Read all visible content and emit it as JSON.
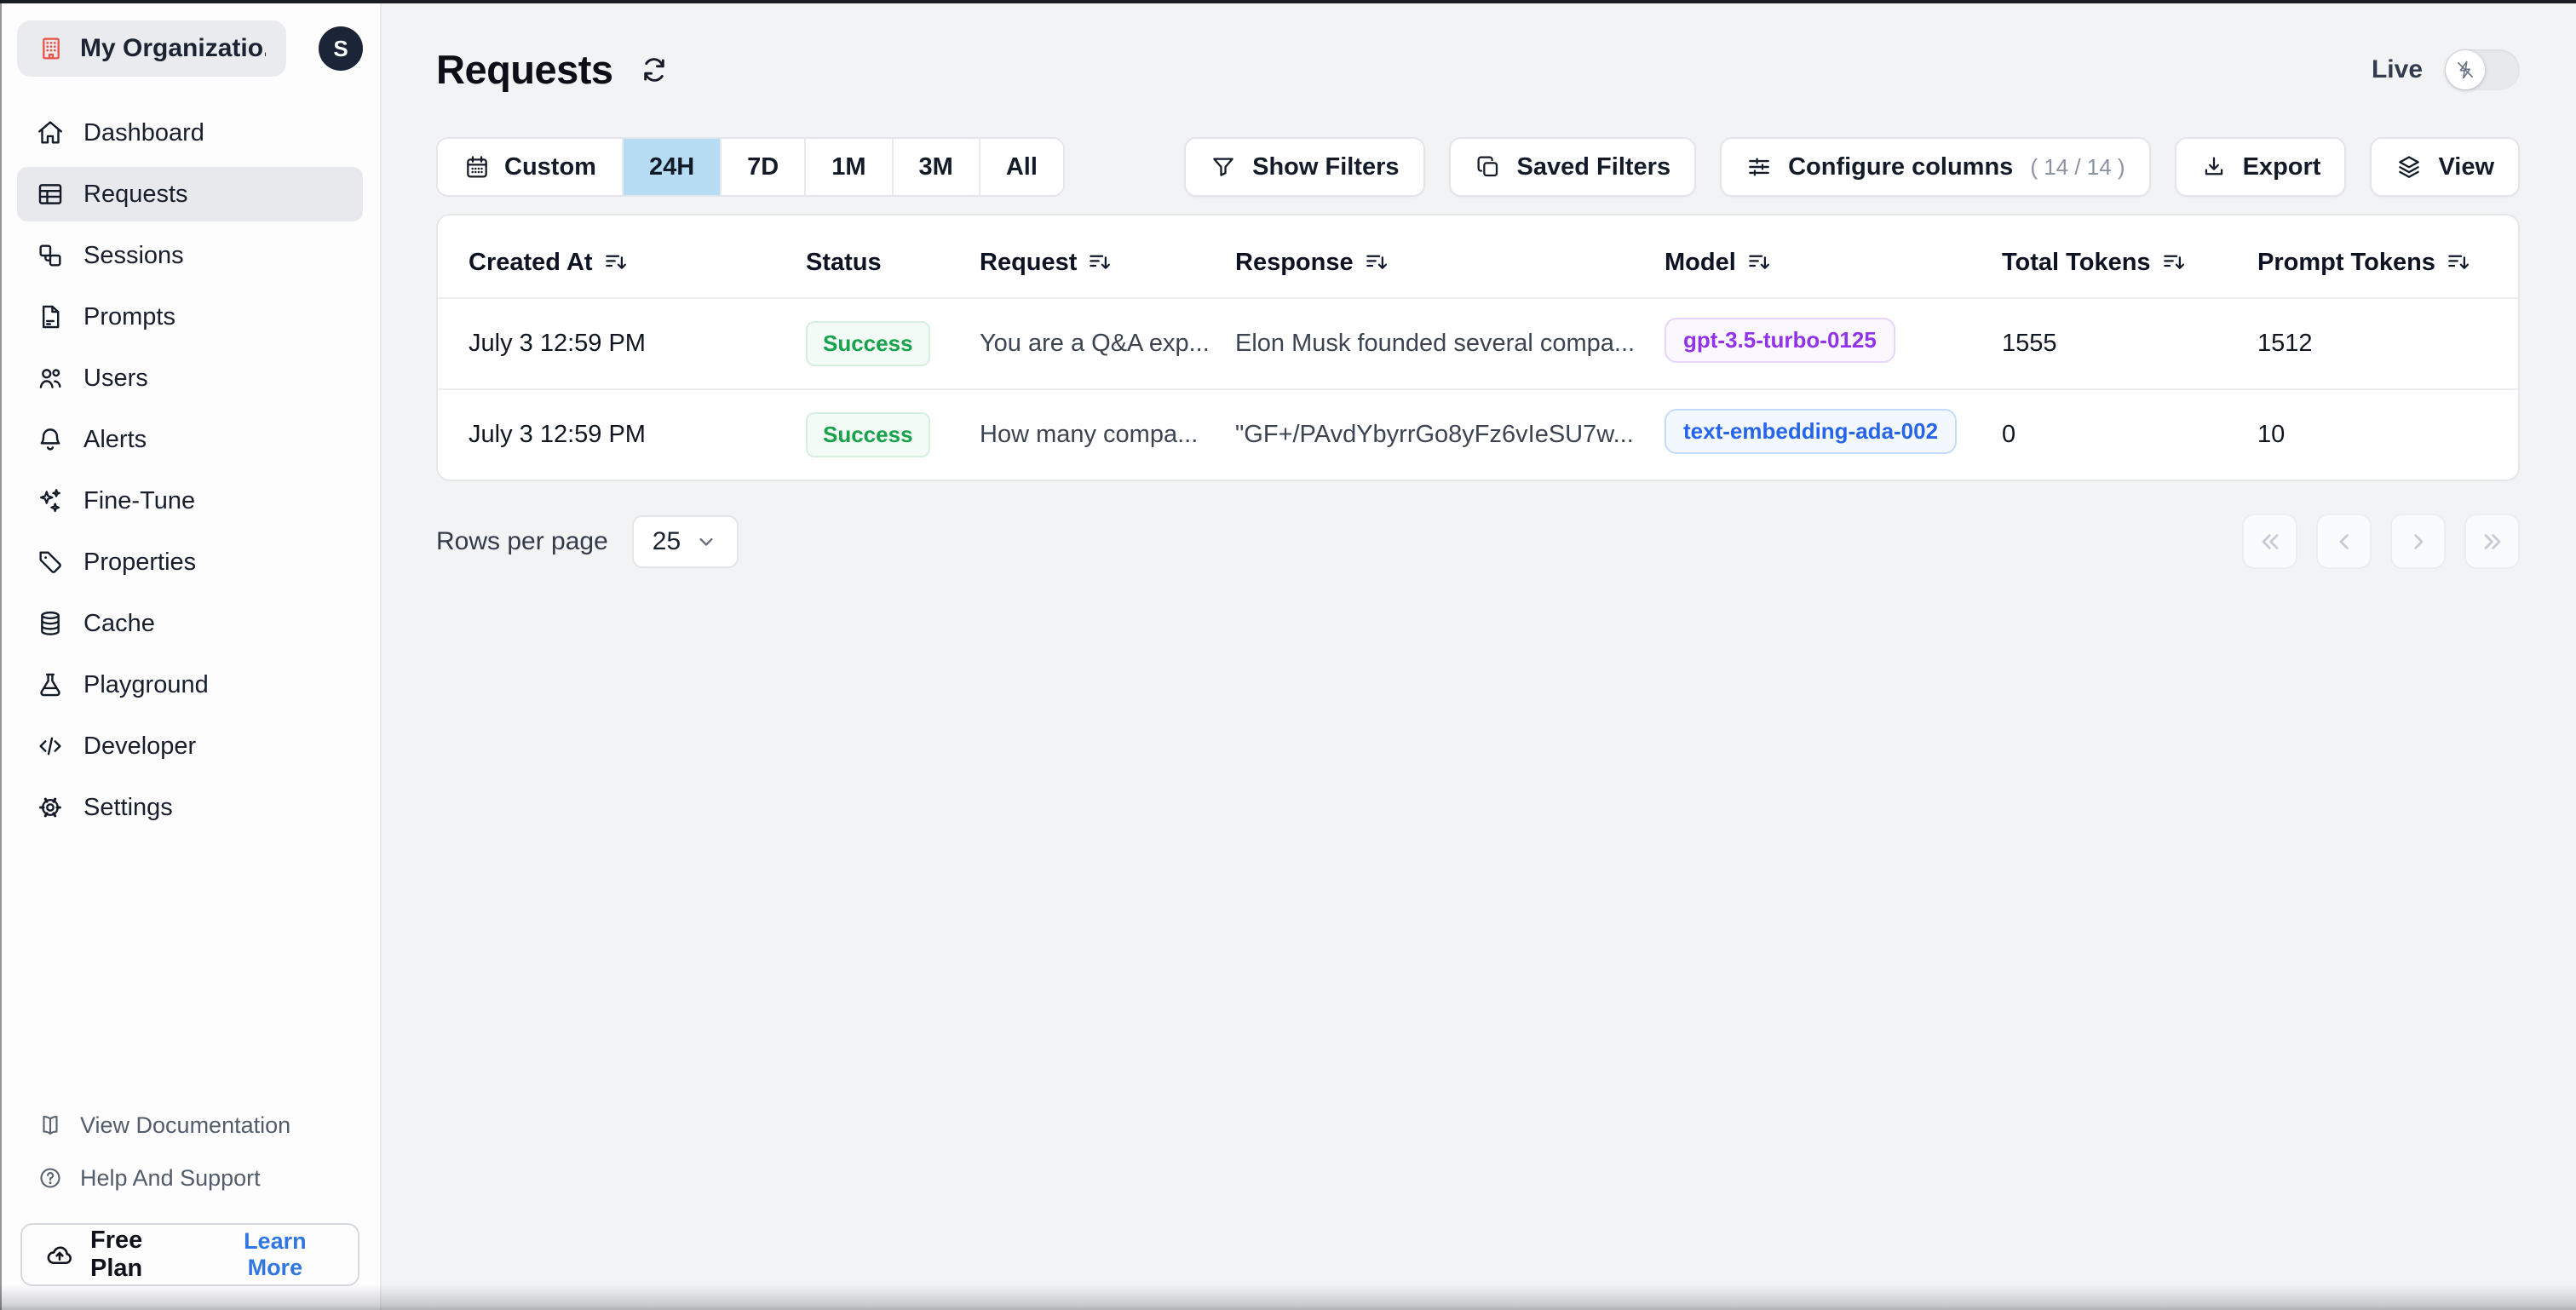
{
  "sidebar": {
    "org_name": "My Organizatio...",
    "avatar_initial": "S",
    "items": [
      {
        "label": "Dashboard",
        "icon": "home-icon",
        "active": false
      },
      {
        "label": "Requests",
        "icon": "table-icon",
        "active": true
      },
      {
        "label": "Sessions",
        "icon": "sessions-icon",
        "active": false
      },
      {
        "label": "Prompts",
        "icon": "document-icon",
        "active": false
      },
      {
        "label": "Users",
        "icon": "users-icon",
        "active": false
      },
      {
        "label": "Alerts",
        "icon": "bell-icon",
        "active": false
      },
      {
        "label": "Fine-Tune",
        "icon": "sparkles-icon",
        "active": false
      },
      {
        "label": "Properties",
        "icon": "tag-icon",
        "active": false
      },
      {
        "label": "Cache",
        "icon": "database-icon",
        "active": false
      },
      {
        "label": "Playground",
        "icon": "beaker-icon",
        "active": false
      },
      {
        "label": "Developer",
        "icon": "code-icon",
        "active": false
      },
      {
        "label": "Settings",
        "icon": "gear-icon",
        "active": false
      }
    ],
    "footer_links": [
      {
        "label": "View Documentation",
        "icon": "book-icon"
      },
      {
        "label": "Help And Support",
        "icon": "help-circle-icon"
      }
    ],
    "plan": {
      "name": "Free Plan",
      "cta": "Learn More",
      "icon": "cloud-upload-icon"
    }
  },
  "header": {
    "title": "Requests",
    "live_label": "Live",
    "live_on": false
  },
  "toolbar": {
    "time_range": {
      "custom_label": "Custom",
      "options": [
        "24H",
        "7D",
        "1M",
        "3M",
        "All"
      ],
      "selected": "24H"
    },
    "buttons": {
      "show_filters": "Show Filters",
      "saved_filters": "Saved Filters",
      "configure_columns": "Configure columns",
      "configure_columns_count": "( 14 / 14 )",
      "export": "Export",
      "view": "View"
    }
  },
  "table": {
    "columns": [
      {
        "label": "Created At",
        "sortable": true
      },
      {
        "label": "Status",
        "sortable": false
      },
      {
        "label": "Request",
        "sortable": true
      },
      {
        "label": "Response",
        "sortable": true
      },
      {
        "label": "Model",
        "sortable": true
      },
      {
        "label": "Total Tokens",
        "sortable": true
      },
      {
        "label": "Prompt Tokens",
        "sortable": true
      }
    ],
    "rows": [
      {
        "created_at": "July 3 12:59 PM",
        "status": "Success",
        "request": "You are a Q&A exp...",
        "response": "Elon Musk founded several compa...",
        "model": "gpt-3.5-turbo-0125",
        "model_color": "purple",
        "total_tokens": "1555",
        "prompt_tokens": "1512"
      },
      {
        "created_at": "July 3 12:59 PM",
        "status": "Success",
        "request": "How many compa...",
        "response": "\"GF+/PAvdYbyrrGo8yFz6vIeSU7w...",
        "model": "text-embedding-ada-002",
        "model_color": "blue",
        "total_tokens": "0",
        "prompt_tokens": "10"
      }
    ]
  },
  "footer": {
    "rows_per_page_label": "Rows per page",
    "rows_per_page_value": "25",
    "pagination_icons": [
      "chevrons-left-icon",
      "chevron-left-icon",
      "chevron-right-icon",
      "chevrons-right-icon"
    ]
  },
  "colors": {
    "brand_red": "#ee4f44",
    "selected_range_bg": "#b5dcf2",
    "success_text": "#18a24b",
    "model_purple": "#9134e9",
    "model_blue": "#2564eb",
    "learn_more_blue": "#3177e2",
    "avatar_bg": "#1b2537",
    "page_bg": "#f2f3f5"
  }
}
